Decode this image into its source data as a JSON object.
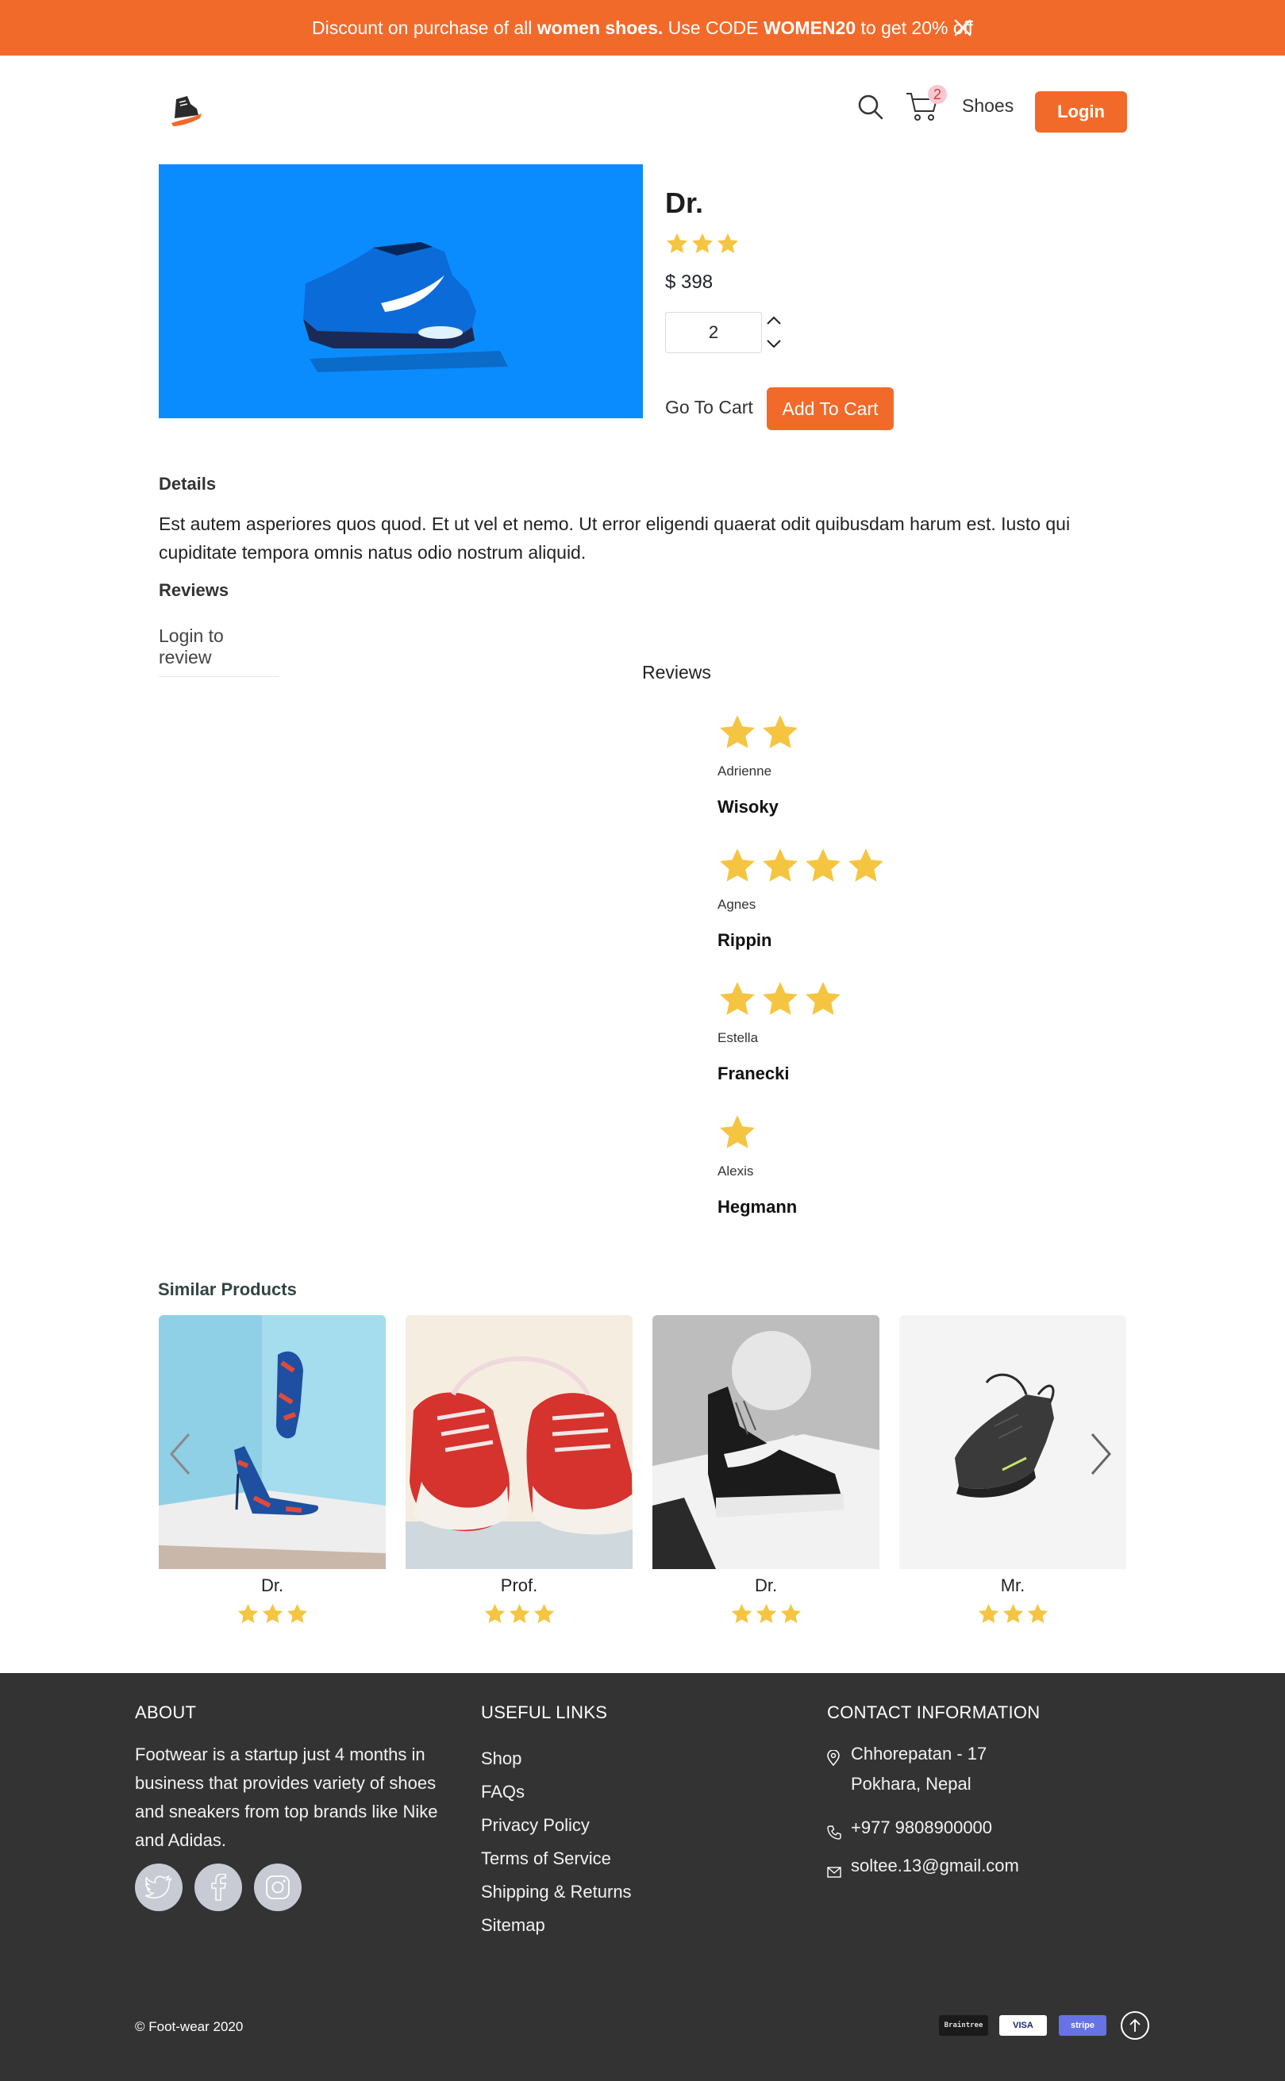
{
  "announcement": {
    "prefix": "Discount on purchase of all ",
    "highlight": "women shoes.",
    "middle": " Use CODE ",
    "code": "WOMEN20",
    "suffix": " to get 20% off"
  },
  "nav": {
    "cart_count": "2",
    "shoes_label": "Shoes",
    "login_label": "Login"
  },
  "product": {
    "title": "Dr.",
    "rating": 3,
    "price": "$ 398",
    "quantity": "2",
    "goto_cart_label": "Go To Cart",
    "add_cart_label": "Add To Cart"
  },
  "details": {
    "heading": "Details",
    "text": "Est autem asperiores quos quod. Et ut vel et nemo. Ut error eligendi quaerat odit quibusdam harum est. Iusto qui cupiditate tempora omnis natus odio nostrum aliquid.",
    "reviews_heading": "Reviews",
    "login_to_review": "Login to review",
    "reviews_center": "Reviews"
  },
  "reviews": [
    {
      "stars": 2,
      "first": "Adrienne",
      "last": "Wisoky"
    },
    {
      "stars": 4,
      "first": "Agnes",
      "last": "Rippin"
    },
    {
      "stars": 3,
      "first": "Estella",
      "last": "Franecki"
    },
    {
      "stars": 1,
      "first": "Alexis",
      "last": "Hegmann"
    }
  ],
  "similar": {
    "heading": "Similar Products",
    "products": [
      {
        "name": "Dr.",
        "rating": 3
      },
      {
        "name": "Prof.",
        "rating": 3
      },
      {
        "name": "Dr.",
        "rating": 3
      },
      {
        "name": "Mr.",
        "rating": 3
      }
    ]
  },
  "footer": {
    "about_heading": "ABOUT",
    "about_text": "Footwear is a startup just 4 months in business that provides variety of shoes and sneakers from top brands like Nike and Adidas.",
    "links_heading": "USEFUL LINKS",
    "links": [
      "Shop",
      "FAQs",
      "Privacy Policy",
      "Terms of Service",
      "Shipping & Returns",
      "Sitemap"
    ],
    "contact_heading": "CONTACT INFORMATION",
    "address_line1": "Chhorepatan - 17",
    "address_line2": "Pokhara, Nepal",
    "phone": "+977 9808900000",
    "email": "soltee.13@gmail.com",
    "copyright": "© Foot-wear 2020",
    "payment_braintree": "Braintree",
    "payment_visa": "VISA",
    "payment_stripe": "stripe"
  },
  "colors": {
    "accent": "#f26a2a",
    "star": "#f5c542",
    "footer_bg": "#333333"
  }
}
